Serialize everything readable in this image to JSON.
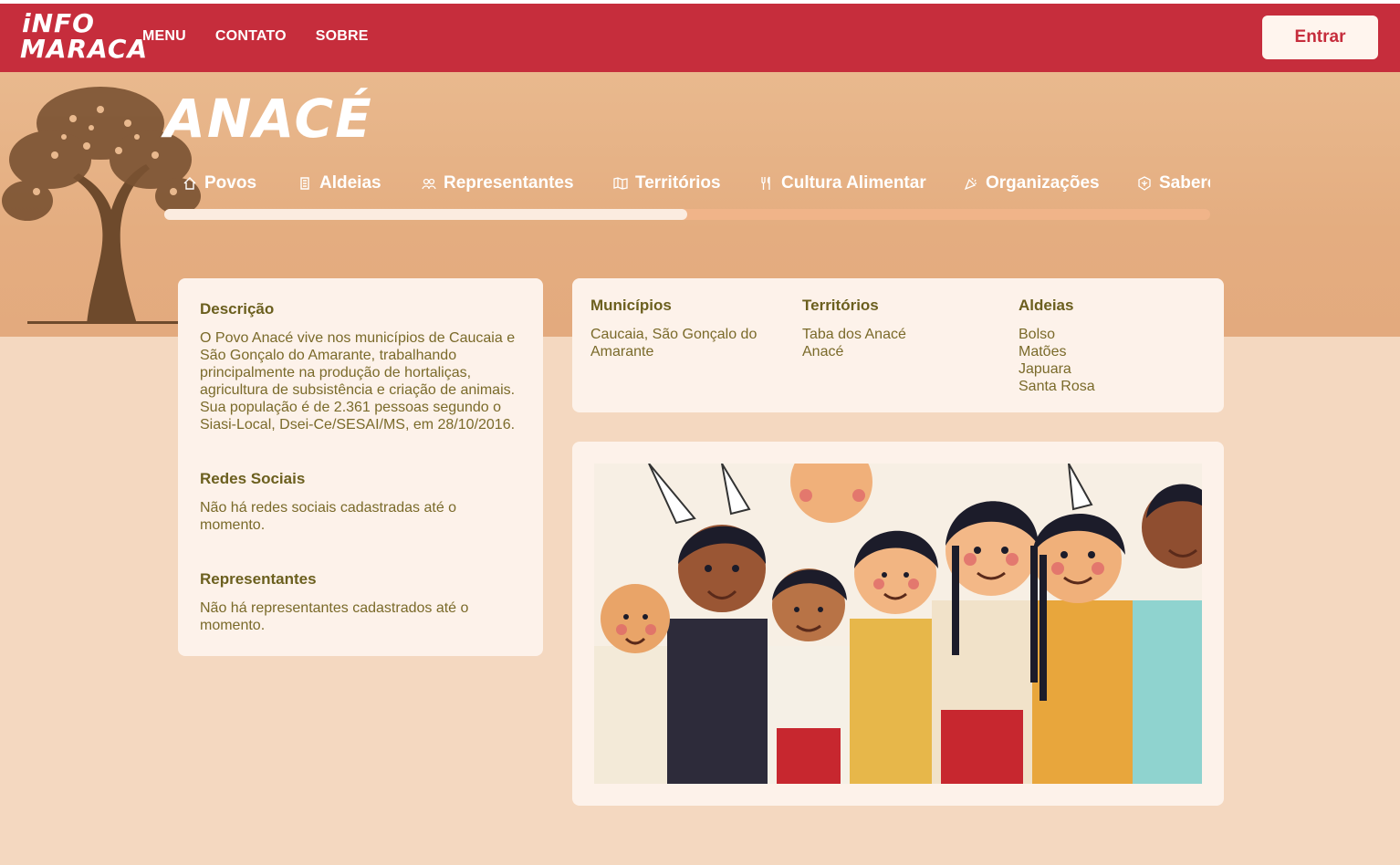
{
  "header": {
    "logo_line1": "iNFO",
    "logo_line2": "MARACA",
    "nav": [
      "MENU",
      "CONTATO",
      "SOBRE"
    ],
    "login_label": "Entrar"
  },
  "hero": {
    "title": "ANACÉ",
    "tabs": [
      {
        "label": "Povos",
        "icon": "home-icon"
      },
      {
        "label": "Aldeias",
        "icon": "building-icon"
      },
      {
        "label": "Representantes",
        "icon": "users-icon"
      },
      {
        "label": "Territórios",
        "icon": "map-icon"
      },
      {
        "label": "Cultura Alimentar",
        "icon": "utensils-icon"
      },
      {
        "label": "Organizações",
        "icon": "party-icon"
      },
      {
        "label": "Saberes",
        "icon": "leaf-icon"
      }
    ],
    "scroll_progress_pct": 50
  },
  "left_card": {
    "descricao_title": "Descrição",
    "descricao_text": "O Povo Anacé vive nos municípios de Caucaia e São Gonçalo do Amarante, trabalhando principalmente na produção de hortaliças, agricultura de subsistência e criação de animais. Sua população é de 2.361 pessoas segundo o Siasi-Local, Dsei-Ce/SESAI/MS, em 28/10/2016.",
    "redes_title": "Redes Sociais",
    "redes_text": "Não há redes sociais cadastradas até o momento.",
    "representantes_title": "Representantes",
    "representantes_text": "Não há representantes cadastrados até o momento."
  },
  "info_card": {
    "municipios_title": "Municípios",
    "municipios_text": "Caucaia, São Gonçalo do Amarante",
    "territorios_title": "Territórios",
    "territorios": [
      "Taba dos Anacé",
      "Anacé"
    ],
    "aldeias_title": "Aldeias",
    "aldeias": [
      "Bolso",
      "Matões",
      "Japuara",
      "Santa Rosa"
    ]
  },
  "colors": {
    "header": "#c62d3c",
    "hero": "#e4ad80",
    "card": "#fdf2ea",
    "heading": "#6b5f1e"
  }
}
